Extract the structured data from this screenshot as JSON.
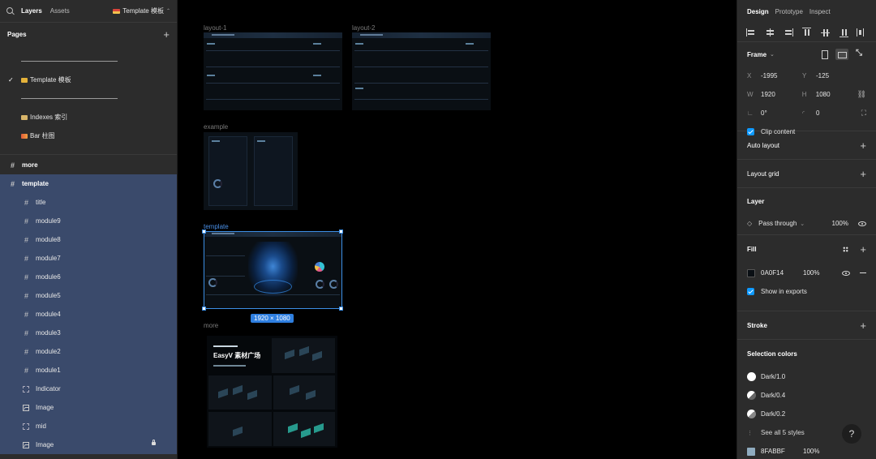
{
  "left_panel": {
    "tabs": [
      "Layers",
      "Assets"
    ],
    "current_page": "Template 模板",
    "pages_title": "Pages",
    "pages": [
      {
        "label": "Template 模板",
        "checked": true
      },
      {
        "label": "Indexes 索引",
        "checked": false
      },
      {
        "label": "Bar 柱图",
        "checked": false
      }
    ],
    "layers": [
      {
        "label": "more",
        "type": "frame",
        "level": 0
      },
      {
        "label": "template",
        "type": "frame",
        "level": 0,
        "selected": true
      },
      {
        "label": "title",
        "type": "frame",
        "level": 1
      },
      {
        "label": "module9",
        "type": "frame",
        "level": 1
      },
      {
        "label": "module8",
        "type": "frame",
        "level": 1
      },
      {
        "label": "module7",
        "type": "frame",
        "level": 1
      },
      {
        "label": "module6",
        "type": "frame",
        "level": 1
      },
      {
        "label": "module5",
        "type": "frame",
        "level": 1
      },
      {
        "label": "module4",
        "type": "frame",
        "level": 1
      },
      {
        "label": "module3",
        "type": "frame",
        "level": 1
      },
      {
        "label": "module2",
        "type": "frame",
        "level": 1
      },
      {
        "label": "module1",
        "type": "frame",
        "level": 1
      },
      {
        "label": "Indicator",
        "type": "component",
        "level": 1
      },
      {
        "label": "Image",
        "type": "image",
        "level": 1
      },
      {
        "label": "mid",
        "type": "component",
        "level": 1
      },
      {
        "label": "Image",
        "type": "image",
        "level": 1,
        "locked": true
      }
    ]
  },
  "canvas": {
    "frames": [
      {
        "label": "layout-1"
      },
      {
        "label": "layout-2"
      },
      {
        "label": "example"
      },
      {
        "label": "template",
        "selected": true
      },
      {
        "label": "more"
      }
    ],
    "selection_size": "1920 × 1080",
    "more_title": "EasyV 素材广场"
  },
  "right_panel": {
    "tabs": [
      "Design",
      "Prototype",
      "Inspect"
    ],
    "frame": {
      "title": "Frame",
      "x_label": "X",
      "x": "-1995",
      "y_label": "Y",
      "y": "-125",
      "w_label": "W",
      "w": "1920",
      "h_label": "H",
      "h": "1080",
      "rotation": "0°",
      "radius": "0",
      "clip_content": "Clip content"
    },
    "auto_layout": "Auto layout",
    "layout_grid": "Layout grid",
    "layer": {
      "title": "Layer",
      "blend": "Pass through",
      "opacity": "100%"
    },
    "fill": {
      "title": "Fill",
      "hex": "0A0F14",
      "opacity": "100%",
      "show_in_exports": "Show in exports",
      "color": "#0A0F14"
    },
    "stroke": "Stroke",
    "selection_colors": {
      "title": "Selection colors",
      "items": [
        {
          "label": "Dark/1.0",
          "color": "#ffffff"
        },
        {
          "label": "Dark/0.4",
          "color": "#9a9a9a"
        },
        {
          "label": "Dark/0.2",
          "color": "#b8b8b8"
        }
      ],
      "see_all": "See all 5 styles",
      "last_hex": "8FABBF",
      "last_opacity": "100%",
      "last_color": "#8FABBF"
    }
  }
}
